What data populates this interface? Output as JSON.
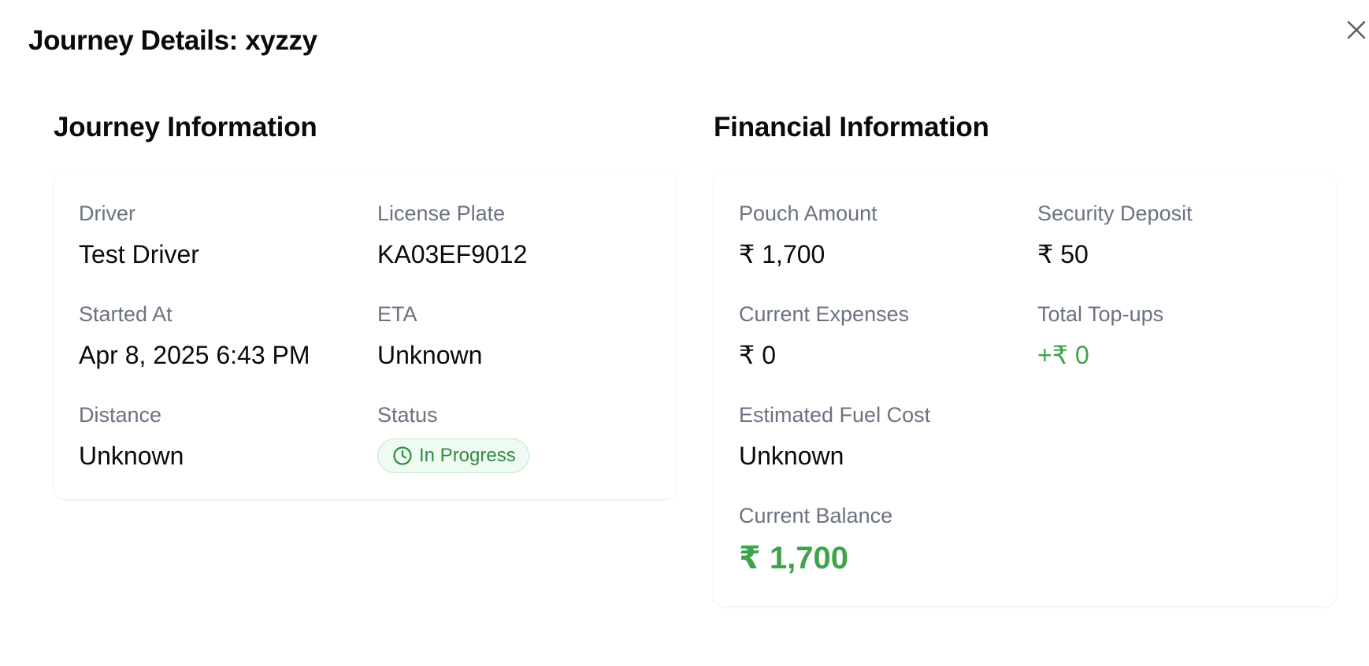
{
  "dialog": {
    "title": "Journey Details: xyzzy"
  },
  "journey": {
    "title": "Journey Information",
    "driver_label": "Driver",
    "driver_value": "Test Driver",
    "license_label": "License Plate",
    "license_value": "KA03EF9012",
    "started_label": "Started At",
    "started_value": "Apr 8, 2025 6:43 PM",
    "eta_label": "ETA",
    "eta_value": "Unknown",
    "distance_label": "Distance",
    "distance_value": "Unknown",
    "status_label": "Status",
    "status_value": "In Progress",
    "status_icon": "clock-icon",
    "status_color": "#2f8a41"
  },
  "finance": {
    "title": "Financial Information",
    "pouch_label": "Pouch Amount",
    "pouch_value": "₹ 1,700",
    "deposit_label": "Security Deposit",
    "deposit_value": "₹ 50",
    "expenses_label": "Current Expenses",
    "expenses_value": "₹ 0",
    "topups_label": "Total Top-ups",
    "topups_value": "+₹ 0",
    "fuel_label": "Estimated Fuel Cost",
    "fuel_value": "Unknown",
    "balance_label": "Current Balance",
    "balance_value": "₹ 1,700",
    "positive_color": "#3ea34a"
  }
}
